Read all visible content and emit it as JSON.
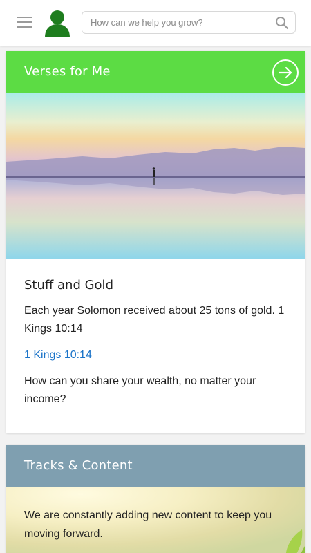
{
  "header": {
    "search_placeholder": "How can we help you grow?",
    "icons": {
      "menu": "hamburger-icon",
      "avatar": "user-avatar-icon",
      "search": "search-icon"
    }
  },
  "verses_card": {
    "title": "Verses for Me",
    "header_color": "#5cdc44",
    "action_icon": "arrow-right-circle-icon",
    "image_alt": "person standing on reflective salt flat at sunrise",
    "entry_title": "Stuff and Gold",
    "verse_text": "Each year Solomon received about 25 tons of gold. 1 Kings 10:14",
    "verse_link": "1 Kings 10:14",
    "question": "How can you share your wealth, no matter your income?"
  },
  "tracks_card": {
    "title": "Tracks & Content",
    "header_color": "#7f9fb0",
    "description": "We are constantly adding new content to keep you moving forward."
  },
  "colors": {
    "link": "#1a73c8",
    "avatar": "#1e7d1e"
  }
}
